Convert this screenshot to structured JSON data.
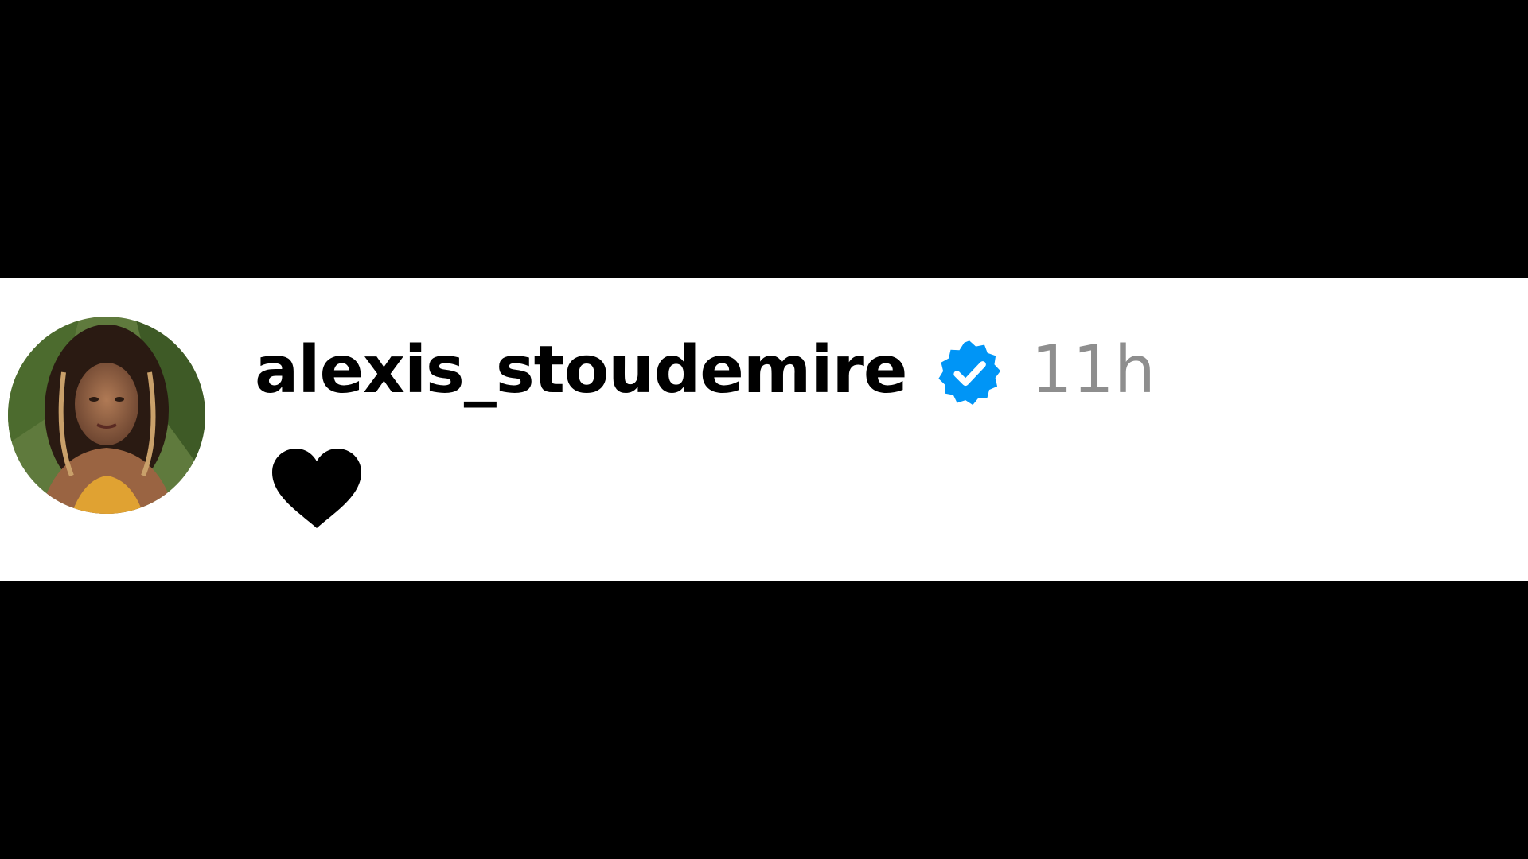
{
  "comment": {
    "username": "alexis_stoudemire",
    "verified": true,
    "timestamp": "11h",
    "body_emoji": "black-heart"
  },
  "colors": {
    "background": "#000000",
    "card": "#ffffff",
    "username": "#000000",
    "timestamp": "#8e8e8e",
    "verified_badge": "#0095f6",
    "heart": "#000000"
  },
  "icons": {
    "avatar": "profile-photo",
    "badge": "verified-badge-icon",
    "emoji": "black-heart-icon"
  }
}
